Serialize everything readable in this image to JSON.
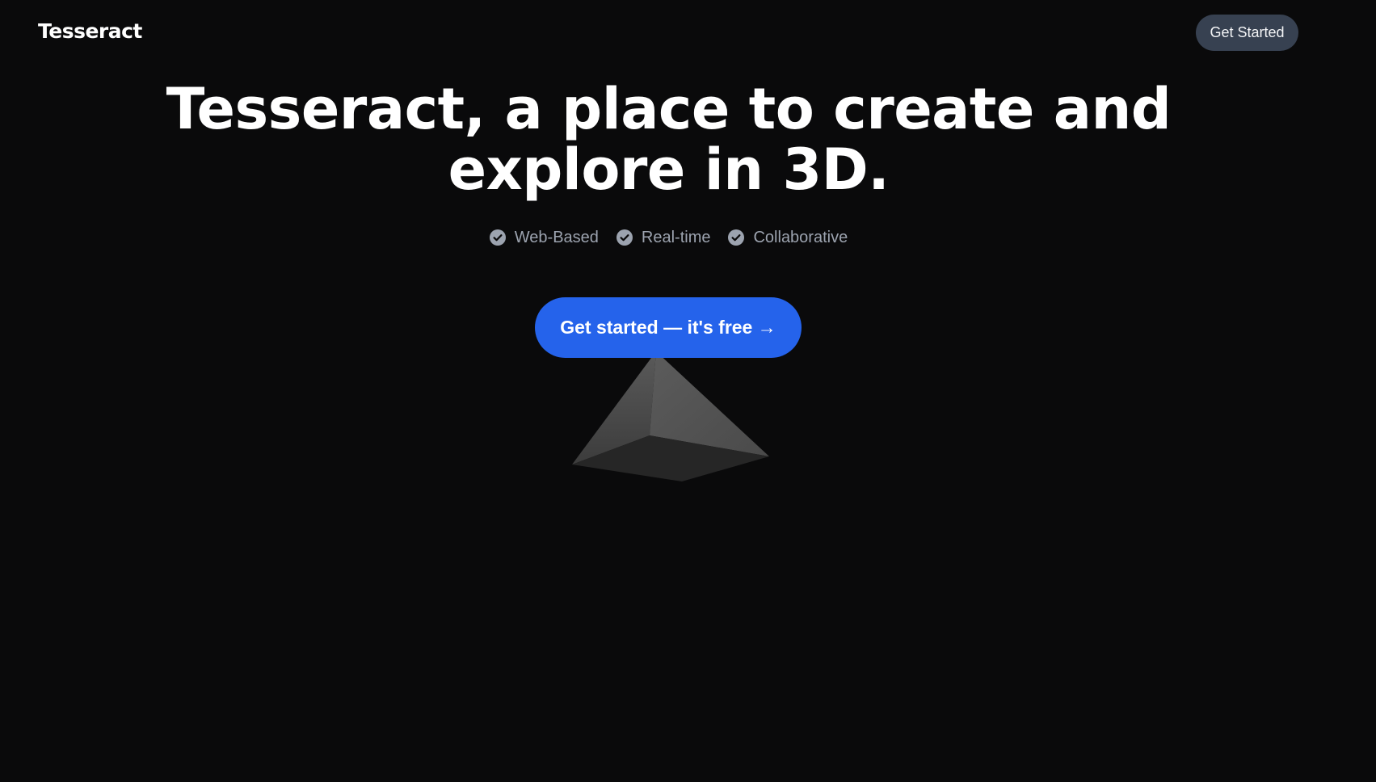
{
  "header": {
    "brand": "Tesseract",
    "nav_cta_label": "Get Started"
  },
  "hero": {
    "title_line1": "Tesseract, a place to create and",
    "title_line2": "explore in 3D.",
    "features": [
      {
        "label": "Web-Based",
        "icon": "check-circle-icon"
      },
      {
        "label": "Real-time",
        "icon": "check-circle-icon"
      },
      {
        "label": "Collaborative",
        "icon": "check-circle-icon"
      }
    ],
    "cta_label": "Get started — it's free →"
  },
  "colors": {
    "background": "#0a0a0b",
    "accent": "#2563eb",
    "nav_button": "#374151",
    "muted_text": "#9ca3af"
  }
}
